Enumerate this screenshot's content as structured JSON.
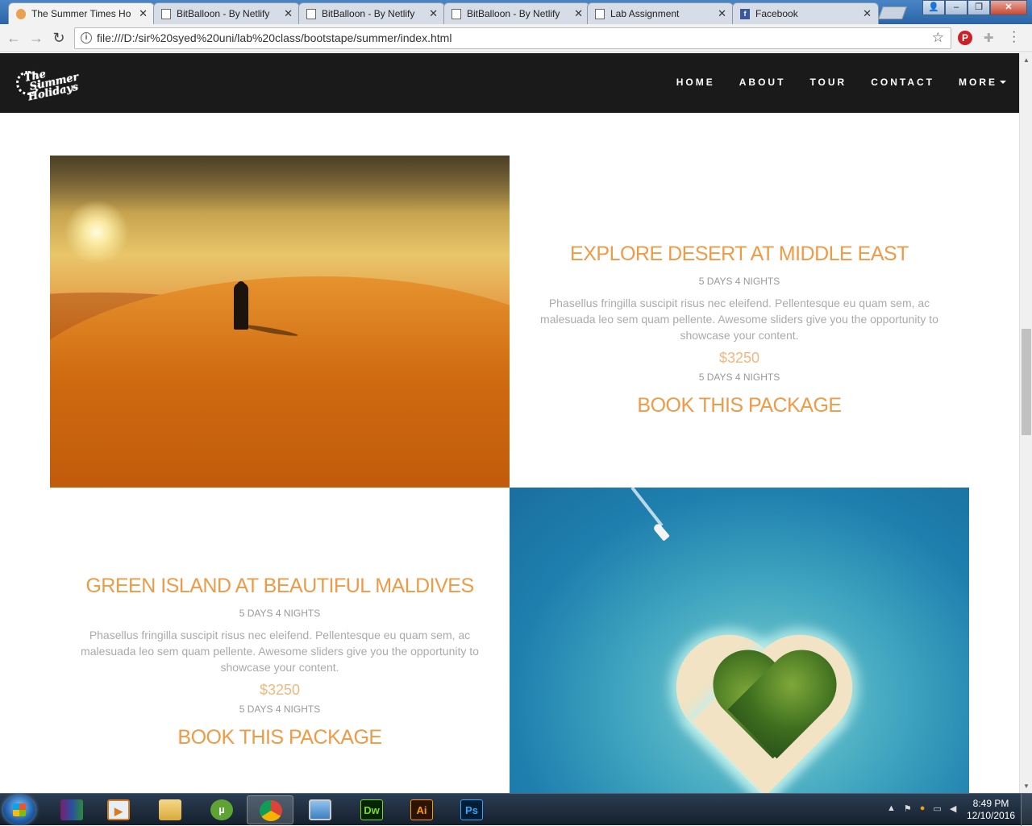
{
  "browser": {
    "tabs": [
      {
        "title": "The Summer Times Ho",
        "icon": "sun-icon"
      },
      {
        "title": "BitBalloon - By Netlify",
        "icon": "page-icon"
      },
      {
        "title": "BitBalloon - By Netlify",
        "icon": "page-icon"
      },
      {
        "title": "BitBalloon - By Netlify",
        "icon": "page-icon"
      },
      {
        "title": "Lab Assignment",
        "icon": "page-icon"
      },
      {
        "title": "Facebook",
        "icon": "facebook-icon"
      }
    ],
    "url": "file:///D:/sir%20syed%20uni/lab%20class/bootstape/summer/index.html"
  },
  "site": {
    "logo_text": "The Summer Holidays",
    "nav": [
      "HOME",
      "ABOUT",
      "TOUR",
      "CONTACT",
      "MORE"
    ]
  },
  "packages": [
    {
      "title": "EXPLORE DESERT AT MIDDLE EAST",
      "duration": "5 DAYS 4 NIGHTS",
      "description": "Phasellus fringilla suscipit risus nec eleifend. Pellentesque eu quam sem, ac malesuada leo sem quam pellente. Awesome sliders give you the opportunity to showcase your content.",
      "price": "$3250",
      "duration_2": "5 DAYS 4 NIGHTS",
      "cta": "BOOK THIS PACKAGE"
    },
    {
      "title": "GREEN ISLAND AT BEAUTIFUL MALDIVES",
      "duration": "5 DAYS 4 NIGHTS",
      "description": "Phasellus fringilla suscipit risus nec eleifend. Pellentesque eu quam sem, ac malesuada leo sem quam pellente. Awesome sliders give you the opportunity to showcase your content.",
      "price": "$3250",
      "duration_2": "5 DAYS 4 NIGHTS",
      "cta": "BOOK THIS PACKAGE"
    }
  ],
  "taskbar": {
    "apps": [
      {
        "name": "winrar-icon",
        "label": ""
      },
      {
        "name": "media-player-icon",
        "label": ""
      },
      {
        "name": "file-explorer-icon",
        "label": ""
      },
      {
        "name": "utorrent-icon",
        "label": ""
      },
      {
        "name": "chrome-icon",
        "label": ""
      },
      {
        "name": "photo-viewer-icon",
        "label": ""
      },
      {
        "name": "dreamweaver-icon",
        "label": "Dw"
      },
      {
        "name": "illustrator-icon",
        "label": "Ai"
      },
      {
        "name": "photoshop-icon",
        "label": "Ps"
      }
    ],
    "time": "8:49 PM",
    "date": "12/10/2016"
  },
  "colors": {
    "accent_orange": "#ef9a45",
    "price_orange": "#f2b77c",
    "nav_bg": "#1a1a1a"
  }
}
